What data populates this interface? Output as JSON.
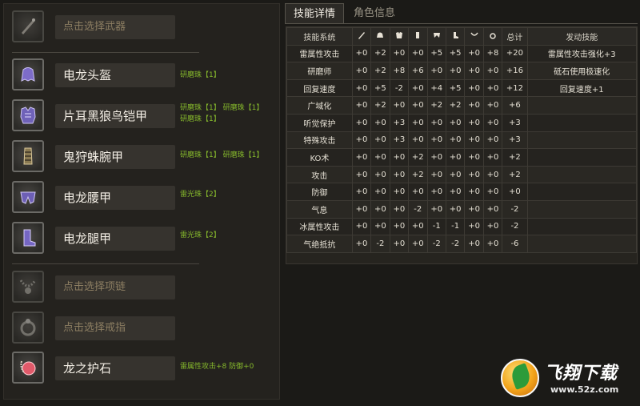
{
  "equipment": {
    "weapon": {
      "label": "点击选择武器",
      "icon": "weapon-placeholder-icon"
    },
    "head": {
      "label": "电龙头盔",
      "decorations": [
        "研磨珠【1】"
      ],
      "icon": "helmet-icon"
    },
    "body": {
      "label": "片耳黑狼鸟铠甲",
      "decorations": [
        "研磨珠【1】 研磨珠【1】",
        "研磨珠【1】"
      ],
      "icon": "chest-armor-icon"
    },
    "arms": {
      "label": "鬼狩蛛腕甲",
      "decorations": [
        "研磨珠【1】 研磨珠【1】"
      ],
      "icon": "arm-guard-icon"
    },
    "waist": {
      "label": "电龙腰甲",
      "decorations": [
        "雷光珠【2】"
      ],
      "icon": "waist-armor-icon"
    },
    "legs": {
      "label": "电龙腿甲",
      "decorations": [
        "雷光珠【2】"
      ],
      "icon": "leg-armor-icon"
    },
    "necklace": {
      "label": "点击选择项链",
      "icon": "necklace-placeholder-icon"
    },
    "ring": {
      "label": "点击选择戒指",
      "icon": "ring-placeholder-icon"
    },
    "charm": {
      "label": "龙之护石",
      "decorations": [
        "雷属性攻击+8 防御+0"
      ],
      "icon": "charm-icon"
    }
  },
  "tabs": [
    {
      "label": "技能详情",
      "active": true
    },
    {
      "label": "角色信息",
      "active": false
    }
  ],
  "skills_table": {
    "headers": {
      "skill_system": "技能系统",
      "total": "总计",
      "activated": "发动技能"
    },
    "header_icons": [
      "weapon-icon",
      "helmet-icon",
      "chest-icon",
      "arm-icon",
      "waist-icon",
      "leg-icon",
      "necklace-icon",
      "ring-icon"
    ],
    "rows": [
      {
        "skill": "雷属性攻击",
        "values": [
          "+0",
          "+2",
          "+0",
          "+0",
          "+5",
          "+5",
          "+0",
          "+8"
        ],
        "total": "+20",
        "activated": "雷属性攻击强化+3"
      },
      {
        "skill": "研磨师",
        "values": [
          "+0",
          "+2",
          "+8",
          "+6",
          "+0",
          "+0",
          "+0",
          "+0"
        ],
        "total": "+16",
        "activated": "砥石使用极速化"
      },
      {
        "skill": "回复速度",
        "values": [
          "+0",
          "+5",
          "-2",
          "+0",
          "+4",
          "+5",
          "+0",
          "+0"
        ],
        "total": "+12",
        "activated": "回复速度+1"
      },
      {
        "skill": "广域化",
        "values": [
          "+0",
          "+2",
          "+0",
          "+0",
          "+2",
          "+2",
          "+0",
          "+0"
        ],
        "total": "+6",
        "activated": ""
      },
      {
        "skill": "听觉保护",
        "values": [
          "+0",
          "+0",
          "+3",
          "+0",
          "+0",
          "+0",
          "+0",
          "+0"
        ],
        "total": "+3",
        "activated": ""
      },
      {
        "skill": "特殊攻击",
        "values": [
          "+0",
          "+0",
          "+3",
          "+0",
          "+0",
          "+0",
          "+0",
          "+0"
        ],
        "total": "+3",
        "activated": ""
      },
      {
        "skill": "KO术",
        "values": [
          "+0",
          "+0",
          "+0",
          "+2",
          "+0",
          "+0",
          "+0",
          "+0"
        ],
        "total": "+2",
        "activated": ""
      },
      {
        "skill": "攻击",
        "values": [
          "+0",
          "+0",
          "+0",
          "+2",
          "+0",
          "+0",
          "+0",
          "+0"
        ],
        "total": "+2",
        "activated": ""
      },
      {
        "skill": "防御",
        "values": [
          "+0",
          "+0",
          "+0",
          "+0",
          "+0",
          "+0",
          "+0",
          "+0"
        ],
        "total": "+0",
        "activated": ""
      },
      {
        "skill": "气息",
        "values": [
          "+0",
          "+0",
          "+0",
          "-2",
          "+0",
          "+0",
          "+0",
          "+0"
        ],
        "total": "-2",
        "activated": ""
      },
      {
        "skill": "冰属性攻击",
        "values": [
          "+0",
          "+0",
          "+0",
          "+0",
          "-1",
          "-1",
          "+0",
          "+0"
        ],
        "total": "-2",
        "activated": ""
      },
      {
        "skill": "气绝抵抗",
        "values": [
          "+0",
          "-2",
          "+0",
          "+0",
          "-2",
          "-2",
          "+0",
          "+0"
        ],
        "total": "-6",
        "activated": ""
      }
    ]
  },
  "watermark": {
    "title": "飞翔下载",
    "url": "www.52z.com"
  },
  "colors": {
    "decoration_text": "#86b92c",
    "placeholder_text": "#8c7e62",
    "background": "#1b1a17"
  }
}
